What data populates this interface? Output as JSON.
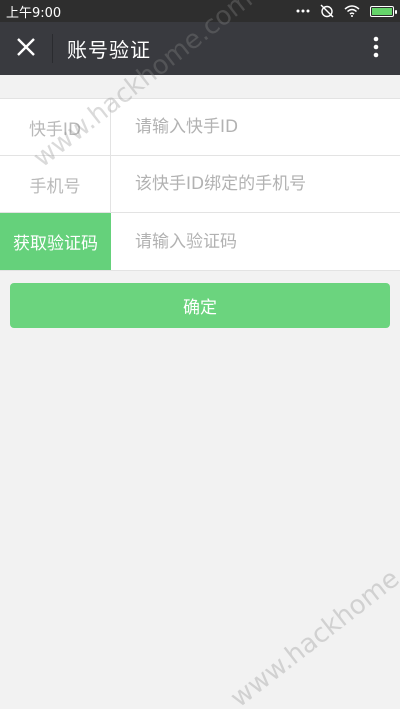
{
  "status_bar": {
    "time": "上午9:00",
    "icons": [
      "dots-icon",
      "alarm-off-icon",
      "wifi-icon",
      "battery-icon"
    ],
    "battery_level": 0.9
  },
  "app_bar": {
    "title": "账号验证",
    "left_icon": "close-icon",
    "right_icon": "more-vertical-icon"
  },
  "form": {
    "rows": [
      {
        "label": "快手ID",
        "placeholder": "请输入快手ID"
      },
      {
        "label": "手机号",
        "placeholder": "该快手ID绑定的手机号"
      },
      {
        "button_label": "获取验证码",
        "placeholder": "请输入验证码"
      }
    ]
  },
  "confirm": {
    "label": "确定"
  },
  "watermarks": [
    "www.hackhome.com",
    "www.hackhome.com"
  ],
  "colors": {
    "status_bar_bg": "#2e2e2e",
    "app_bar_bg": "#393a3f",
    "accent_green": "#65d17b",
    "page_bg": "#f2f2f2"
  }
}
